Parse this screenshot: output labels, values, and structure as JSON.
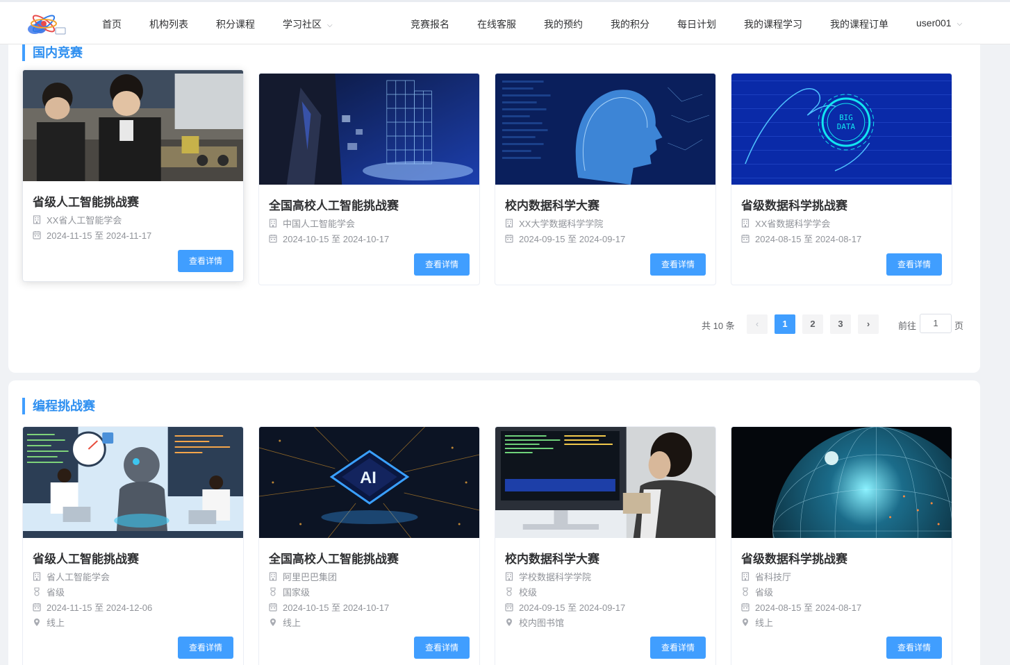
{
  "nav": {
    "items_left": [
      {
        "label": "首页",
        "name": "nav-home"
      },
      {
        "label": "机构列表",
        "name": "nav-institutions"
      },
      {
        "label": "积分课程",
        "name": "nav-points-courses"
      },
      {
        "label": "学习社区",
        "name": "nav-community",
        "dropdown": true
      }
    ],
    "items_right": [
      {
        "label": "竞赛报名",
        "name": "nav-competition-signup"
      },
      {
        "label": "在线客服",
        "name": "nav-online-service"
      },
      {
        "label": "我的预约",
        "name": "nav-my-reservations"
      },
      {
        "label": "我的积分",
        "name": "nav-my-points"
      },
      {
        "label": "每日计划",
        "name": "nav-daily-plan"
      },
      {
        "label": "我的课程学习",
        "name": "nav-my-course-study"
      },
      {
        "label": "我的课程订单",
        "name": "nav-my-course-orders"
      },
      {
        "label": "user001",
        "name": "nav-user-menu",
        "dropdown": true
      }
    ]
  },
  "domestic": {
    "title": "国内竞赛",
    "cards": [
      {
        "title": "省级人工智能挑战赛",
        "org": "XX省人工智能学会",
        "date": "2024-11-15 至 2024-11-17",
        "button": "查看详情",
        "image": "kids-robotics-photo"
      },
      {
        "title": "全国高校人工智能挑战赛",
        "org": "中国人工智能学会",
        "date": "2024-10-15 至 2024-10-17",
        "button": "查看详情",
        "image": "hologram-building-photo"
      },
      {
        "title": "校内数据科学大赛",
        "org": "XX大学数据科学学院",
        "date": "2024-09-15 至 2024-09-17",
        "button": "查看详情",
        "image": "digital-face-photo"
      },
      {
        "title": "省级数据科学挑战赛",
        "org": "XX省数据科学学会",
        "date": "2024-08-15 至 2024-08-17",
        "button": "查看详情",
        "image": "big-data-hand-photo"
      }
    ],
    "pagination": {
      "total": "共 10 条",
      "pages": [
        "1",
        "2",
        "3"
      ],
      "current": "1",
      "goto_label": "前往",
      "goto_value": "1",
      "unit": "页"
    }
  },
  "programming": {
    "title": "编程挑战赛",
    "cards": [
      {
        "title": "省级人工智能挑战赛",
        "org": "省人工智能学会",
        "level": "省级",
        "date": "2024-11-15 至 2024-12-06",
        "location": "线上",
        "button": "查看详情",
        "image": "ai-robot-illustration"
      },
      {
        "title": "全国高校人工智能挑战赛",
        "org": "阿里巴巴集团",
        "level": "国家级",
        "date": "2024-10-15 至 2024-10-17",
        "location": "线上",
        "button": "查看详情",
        "image": "ai-chip-photo",
        "image_text": "AI"
      },
      {
        "title": "校内数据科学大赛",
        "org": "学校数据科学学院",
        "level": "校级",
        "date": "2024-09-15 至 2024-09-17",
        "location": "校内图书馆",
        "button": "查看详情",
        "image": "programmer-monitor-photo"
      },
      {
        "title": "省级数据科学挑战赛",
        "org": "省科技厅",
        "level": "省级",
        "date": "2024-08-15 至 2024-08-17",
        "location": "线上",
        "button": "查看详情",
        "image": "network-globe-photo"
      }
    ]
  },
  "image_labels": {
    "big_data_line1": "BIG",
    "big_data_line2": "DATA",
    "chip": "AI"
  },
  "colors": {
    "accent": "#409eff",
    "title_blue": "#2e8ff0",
    "text": "#303133",
    "muted": "#909399"
  }
}
